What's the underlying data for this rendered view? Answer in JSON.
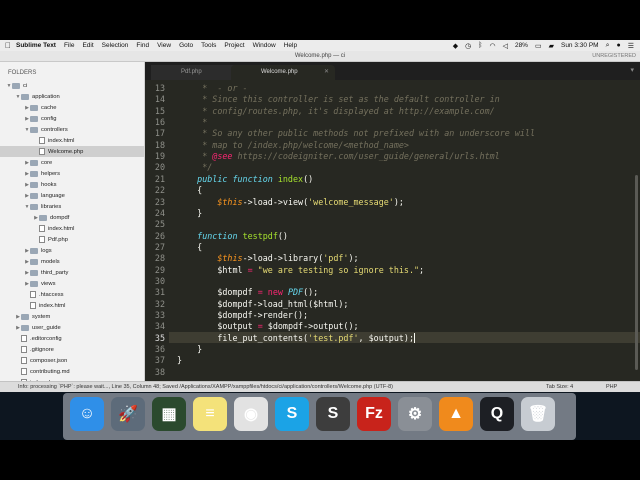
{
  "menubar": {
    "app_name": "Sublime Text",
    "items": [
      "File",
      "Edit",
      "Selection",
      "Find",
      "View",
      "Goto",
      "Tools",
      "Project",
      "Window",
      "Help"
    ],
    "battery": "28%",
    "clock": "Sun 3:30 PM"
  },
  "window": {
    "title": "Welcome.php — ci",
    "unregistered": "UNREGISTERED"
  },
  "sidebar": {
    "header": "FOLDERS",
    "tree": [
      {
        "label": "ci",
        "kind": "folder",
        "depth": 0,
        "open": true
      },
      {
        "label": "application",
        "kind": "folder",
        "depth": 1,
        "open": true
      },
      {
        "label": "cache",
        "kind": "folder",
        "depth": 2,
        "open": false
      },
      {
        "label": "config",
        "kind": "folder",
        "depth": 2,
        "open": false
      },
      {
        "label": "controllers",
        "kind": "folder",
        "depth": 2,
        "open": true
      },
      {
        "label": "index.html",
        "kind": "file",
        "depth": 3
      },
      {
        "label": "Welcome.php",
        "kind": "file",
        "depth": 3,
        "selected": true
      },
      {
        "label": "core",
        "kind": "folder",
        "depth": 2,
        "open": false
      },
      {
        "label": "helpers",
        "kind": "folder",
        "depth": 2,
        "open": false
      },
      {
        "label": "hooks",
        "kind": "folder",
        "depth": 2,
        "open": false
      },
      {
        "label": "language",
        "kind": "folder",
        "depth": 2,
        "open": false
      },
      {
        "label": "libraries",
        "kind": "folder",
        "depth": 2,
        "open": true
      },
      {
        "label": "dompdf",
        "kind": "folder",
        "depth": 3,
        "open": false
      },
      {
        "label": "index.html",
        "kind": "file",
        "depth": 3
      },
      {
        "label": "Pdf.php",
        "kind": "file",
        "depth": 3
      },
      {
        "label": "logs",
        "kind": "folder",
        "depth": 2,
        "open": false
      },
      {
        "label": "models",
        "kind": "folder",
        "depth": 2,
        "open": false
      },
      {
        "label": "third_party",
        "kind": "folder",
        "depth": 2,
        "open": false
      },
      {
        "label": "views",
        "kind": "folder",
        "depth": 2,
        "open": false
      },
      {
        "label": ".htaccess",
        "kind": "file",
        "depth": 2
      },
      {
        "label": "index.html",
        "kind": "file",
        "depth": 2
      },
      {
        "label": "system",
        "kind": "folder",
        "depth": 1,
        "open": false
      },
      {
        "label": "user_guide",
        "kind": "folder",
        "depth": 1,
        "open": false
      },
      {
        "label": ".editorconfig",
        "kind": "file",
        "depth": 1
      },
      {
        "label": ".gitignore",
        "kind": "file",
        "depth": 1
      },
      {
        "label": "composer.json",
        "kind": "file",
        "depth": 1
      },
      {
        "label": "contributing.md",
        "kind": "file",
        "depth": 1
      },
      {
        "label": "index.php",
        "kind": "file",
        "depth": 1
      }
    ]
  },
  "tabs": [
    {
      "label": "Pdf.php",
      "active": false
    },
    {
      "label": "Welcome.php",
      "active": true
    }
  ],
  "editor": {
    "current_line": 35,
    "lines": [
      {
        "n": "13",
        "segs": [
          [
            "cmt",
            "     *  - or -"
          ]
        ]
      },
      {
        "n": "14",
        "segs": [
          [
            "cmt",
            "     * Since this controller is set as the default controller in"
          ]
        ]
      },
      {
        "n": "15",
        "segs": [
          [
            "cmt",
            "     * config/routes.php, it's displayed at http://example.com/"
          ]
        ]
      },
      {
        "n": "16",
        "segs": [
          [
            "cmt",
            "     *"
          ]
        ]
      },
      {
        "n": "17",
        "segs": [
          [
            "cmt",
            "     * So any other public methods not prefixed with an underscore will"
          ]
        ]
      },
      {
        "n": "18",
        "segs": [
          [
            "cmt",
            "     * map to /index.php/welcome/<method_name>"
          ]
        ]
      },
      {
        "n": "19",
        "segs": [
          [
            "cmt",
            "     * "
          ],
          [
            "cmtat",
            "@see"
          ],
          [
            "cmt",
            " https://codeigniter.com/user_guide/general/urls.html"
          ]
        ]
      },
      {
        "n": "20",
        "segs": [
          [
            "cmt",
            "     */"
          ]
        ]
      },
      {
        "n": "21",
        "segs": [
          [
            "kw",
            "    public function "
          ],
          [
            "fn",
            "index"
          ],
          [
            "txt",
            "()"
          ]
        ]
      },
      {
        "n": "22",
        "segs": [
          [
            "txt",
            "    {"
          ]
        ]
      },
      {
        "n": "23",
        "segs": [
          [
            "var",
            "        $this"
          ],
          [
            "txt",
            "->load->view("
          ],
          [
            "str",
            "'welcome_message'"
          ],
          [
            "txt",
            ");"
          ]
        ]
      },
      {
        "n": "24",
        "segs": [
          [
            "txt",
            "    }"
          ]
        ]
      },
      {
        "n": "25",
        "segs": [
          [
            "txt",
            ""
          ]
        ]
      },
      {
        "n": "26",
        "segs": [
          [
            "kw",
            "    function "
          ],
          [
            "fn",
            "testpdf"
          ],
          [
            "txt",
            "()"
          ]
        ]
      },
      {
        "n": "27",
        "segs": [
          [
            "txt",
            "    {"
          ]
        ]
      },
      {
        "n": "28",
        "segs": [
          [
            "var",
            "        $this"
          ],
          [
            "txt",
            "->load->library("
          ],
          [
            "str",
            "'pdf'"
          ],
          [
            "txt",
            ");"
          ]
        ]
      },
      {
        "n": "29",
        "segs": [
          [
            "txt",
            "        $html "
          ],
          [
            "kw2",
            "="
          ],
          [
            "str",
            " \"we are testing so ignore this.\""
          ],
          [
            "txt",
            ";"
          ]
        ]
      },
      {
        "n": "30",
        "segs": [
          [
            "txt",
            ""
          ]
        ]
      },
      {
        "n": "31",
        "segs": [
          [
            "txt",
            "        $dompdf "
          ],
          [
            "kw2",
            "= new "
          ],
          [
            "cls",
            "PDF"
          ],
          [
            "txt",
            "();"
          ]
        ]
      },
      {
        "n": "32",
        "segs": [
          [
            "txt",
            "        $dompdf->load_html($html);"
          ]
        ]
      },
      {
        "n": "33",
        "segs": [
          [
            "txt",
            "        $dompdf->render();"
          ]
        ]
      },
      {
        "n": "34",
        "segs": [
          [
            "txt",
            "        $output "
          ],
          [
            "kw2",
            "="
          ],
          [
            "txt",
            " $dompdf->output();"
          ]
        ]
      },
      {
        "n": "35",
        "segs": [
          [
            "txt",
            "        file_put_contents("
          ],
          [
            "str",
            "'test.pdf'"
          ],
          [
            "txt",
            ", $output);"
          ]
        ]
      },
      {
        "n": "36",
        "segs": [
          [
            "txt",
            "    }"
          ]
        ]
      },
      {
        "n": "37",
        "segs": [
          [
            "txt",
            "}"
          ]
        ]
      },
      {
        "n": "38",
        "segs": [
          [
            "txt",
            ""
          ]
        ]
      }
    ]
  },
  "statusbar": {
    "message": "Info: processing `PHP`: please wait..., Line 35, Column 48; Saved /Applications/XAMPP/xamppfiles/htdocs/ci/application/controllers/Welcome.php (UTF-8)",
    "tab_size": "Tab Size: 4",
    "syntax": "PHP"
  },
  "dock": {
    "apps": [
      {
        "name": "Finder",
        "color": "#2f8fe8",
        "glyph": "☺"
      },
      {
        "name": "Launchpad",
        "color": "#5d6b7a",
        "glyph": "🚀"
      },
      {
        "name": "Mission Control",
        "color": "#2b4a2e",
        "glyph": "▦"
      },
      {
        "name": "Notes",
        "color": "#f4e27a",
        "glyph": "≡"
      },
      {
        "name": "Chrome",
        "color": "#e2e2e2",
        "glyph": "◉"
      },
      {
        "name": "Skype",
        "color": "#1ba3e6",
        "glyph": "S"
      },
      {
        "name": "Sublime Text",
        "color": "#3d3d3d",
        "glyph": "S"
      },
      {
        "name": "FileZilla",
        "color": "#c8231b",
        "glyph": "Fz"
      },
      {
        "name": "System Preferences",
        "color": "#8a8f96",
        "glyph": "⚙"
      },
      {
        "name": "VLC",
        "color": "#f08a1c",
        "glyph": "▲"
      },
      {
        "name": "QuickTime",
        "color": "#1d1f24",
        "glyph": "Q"
      },
      {
        "name": "Trash",
        "color": "#c7ccd2",
        "glyph": "🗑"
      }
    ]
  }
}
